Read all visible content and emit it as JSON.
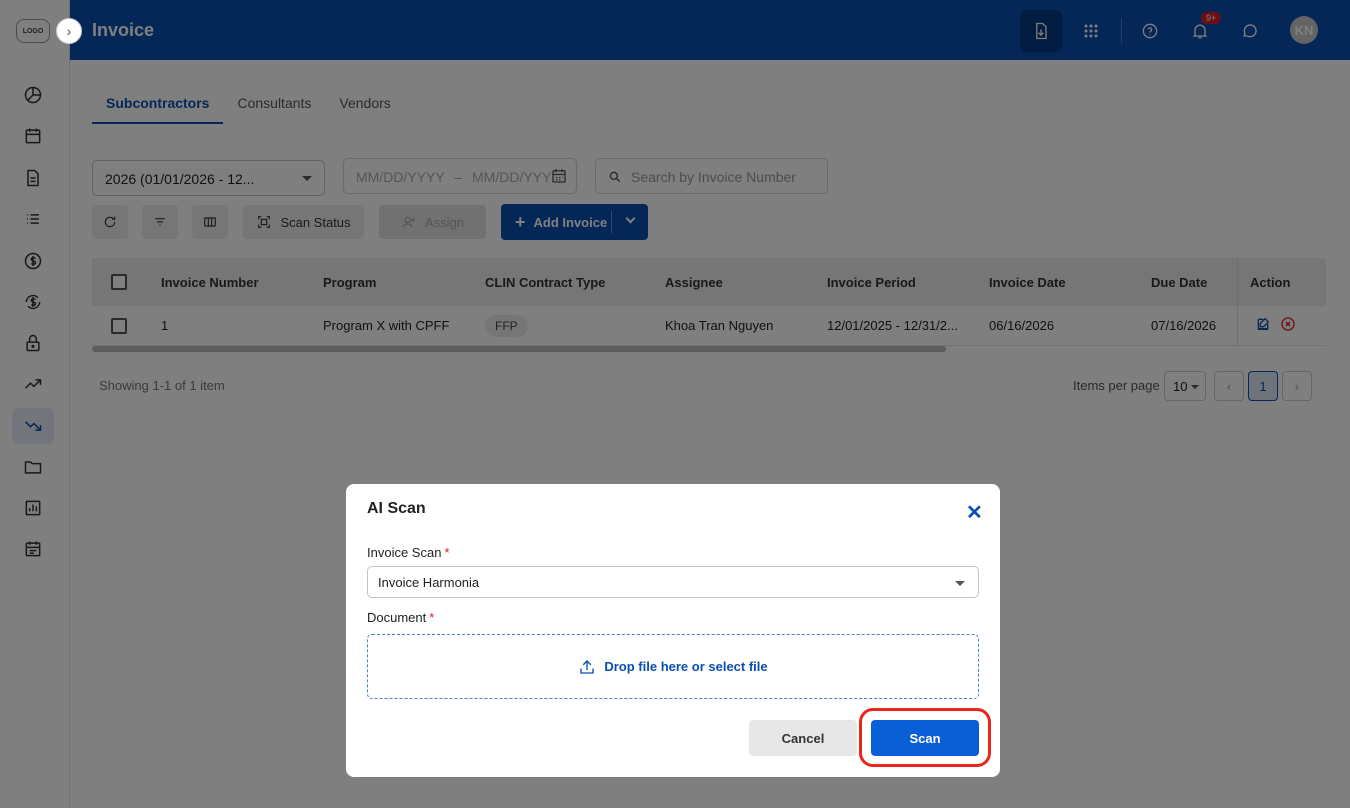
{
  "app": {
    "logo_text": "LOGO",
    "title": "Invoice",
    "notification_badge": "9+",
    "avatar_initials": "KN"
  },
  "sidebar": {
    "icons": [
      "dashboard-icon",
      "calendar-icon",
      "document-icon",
      "list-icon",
      "dollar-icon",
      "exchange-dollar-icon",
      "lock-icon",
      "trend-up-icon",
      "trend-down-icon",
      "folder-icon",
      "report-icon",
      "schedule-icon"
    ],
    "active": "trend-down-icon"
  },
  "tabs": [
    {
      "label": "Subcontractors",
      "active": true
    },
    {
      "label": "Consultants",
      "active": false
    },
    {
      "label": "Vendors",
      "active": false
    }
  ],
  "filters": {
    "year_value": "2026 (01/01/2026 - 12...",
    "date_start_placeholder": "MM/DD/YYYY",
    "date_separator": "–",
    "date_end_placeholder": "MM/DD/YYY",
    "search_placeholder": "Search by Invoice Number"
  },
  "toolbar": {
    "scan_status_label": "Scan Status",
    "assign_label": "Assign",
    "add_invoice_label": "Add Invoice"
  },
  "table": {
    "columns": [
      "Invoice Number",
      "Program",
      "CLIN Contract Type",
      "Assignee",
      "Invoice Period",
      "Invoice Date",
      "Due Date",
      "Action"
    ],
    "rows": [
      {
        "invoice_number": "1",
        "program": "Program X with CPFF",
        "clin_contract_type": "FFP",
        "assignee": "Khoa Tran Nguyen",
        "invoice_period": "12/01/2025 - 12/31/2...",
        "invoice_date": "06/16/2026",
        "due_date": "07/16/2026"
      }
    ]
  },
  "pagination": {
    "showing_text": "Showing 1-1 of 1 item",
    "items_per_page_label": "Items per page",
    "items_per_page_value": "10",
    "current_page": "1"
  },
  "modal": {
    "title": "AI Scan",
    "invoice_scan_label": "Invoice Scan",
    "invoice_scan_value": "Invoice Harmonia",
    "document_label": "Document",
    "required_mark": "*",
    "dropzone_text": "Drop file here or select file",
    "cancel_label": "Cancel",
    "scan_label": "Scan"
  },
  "colors": {
    "primary": "#0a4fb0",
    "scan_button": "#0b5fd6",
    "highlight": "#e8261c",
    "required": "#d71f2b"
  }
}
